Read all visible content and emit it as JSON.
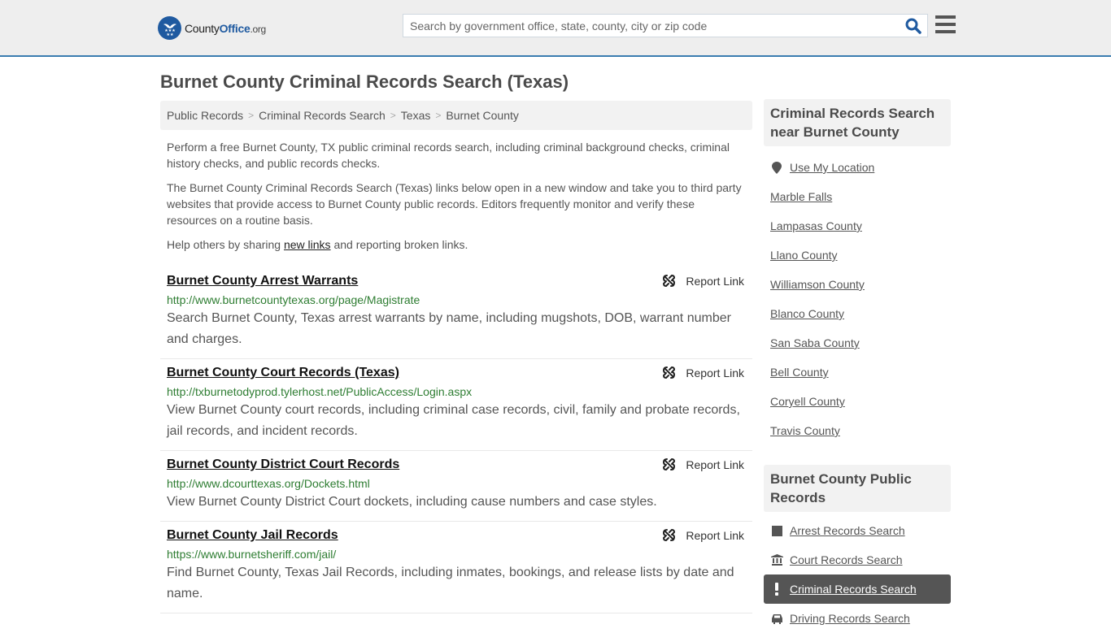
{
  "header": {
    "logo": {
      "name_part1": "County",
      "name_part2": "Office",
      "name_part3": ".org"
    },
    "search": {
      "placeholder": "Search by government office, state, county, city or zip code",
      "value": ""
    },
    "colors": {
      "brand": "#1f5aa0",
      "header_border": "#3a7cb0"
    }
  },
  "page": {
    "title": "Burnet County Criminal Records Search (Texas)"
  },
  "breadcrumb": [
    {
      "label": "Public Records"
    },
    {
      "label": "Criminal Records Search"
    },
    {
      "label": "Texas"
    },
    {
      "label": "Burnet County"
    }
  ],
  "intro": {
    "p1": "Perform a free Burnet County, TX public criminal records search, including criminal background checks, criminal history checks, and public records checks.",
    "p2": "The Burnet County Criminal Records Search (Texas) links below open in a new window and take you to third party websites that provide access to Burnet County public records. Editors frequently monitor and verify these resources on a routine basis.",
    "p3_before": "Help others by sharing ",
    "p3_link": "new links",
    "p3_after": " and reporting broken links."
  },
  "results": [
    {
      "title": "Burnet County Arrest Warrants",
      "url": "http://www.burnetcountytexas.org/page/Magistrate",
      "description": "Search Burnet County, Texas arrest warrants by name, including mugshots, DOB, warrant number and charges.",
      "report_label": "Report Link"
    },
    {
      "title": "Burnet County Court Records (Texas)",
      "url": "http://txburnetodyprod.tylerhost.net/PublicAccess/Login.aspx",
      "description": "View Burnet County court records, including criminal case records, civil, family and probate records, jail records, and incident records.",
      "report_label": "Report Link"
    },
    {
      "title": "Burnet County District Court Records",
      "url": "http://www.dcourttexas.org/Dockets.html",
      "description": "View Burnet County District Court dockets, including cause numbers and case styles.",
      "report_label": "Report Link"
    },
    {
      "title": "Burnet County Jail Records",
      "url": "https://www.burnetsheriff.com/jail/",
      "description": "Find Burnet County, Texas Jail Records, including inmates, bookings, and release lists by date and name.",
      "report_label": "Report Link"
    }
  ],
  "sidebar": {
    "nearby": {
      "heading": "Criminal Records Search near Burnet County",
      "use_location": "Use My Location",
      "items": [
        {
          "label": "Marble Falls"
        },
        {
          "label": "Lampasas County"
        },
        {
          "label": "Llano County"
        },
        {
          "label": "Williamson County"
        },
        {
          "label": "Blanco County"
        },
        {
          "label": "San Saba County"
        },
        {
          "label": "Bell County"
        },
        {
          "label": "Coryell County"
        },
        {
          "label": "Travis County"
        }
      ]
    },
    "public_records": {
      "heading": "Burnet County Public Records",
      "items": [
        {
          "label": "Arrest Records Search",
          "icon": "square-icon"
        },
        {
          "label": "Court Records Search",
          "icon": "courthouse-icon"
        },
        {
          "label": "Criminal Records Search",
          "icon": "exclamation-icon",
          "active": true
        },
        {
          "label": "Driving Records Search",
          "icon": "car-icon"
        }
      ]
    }
  }
}
